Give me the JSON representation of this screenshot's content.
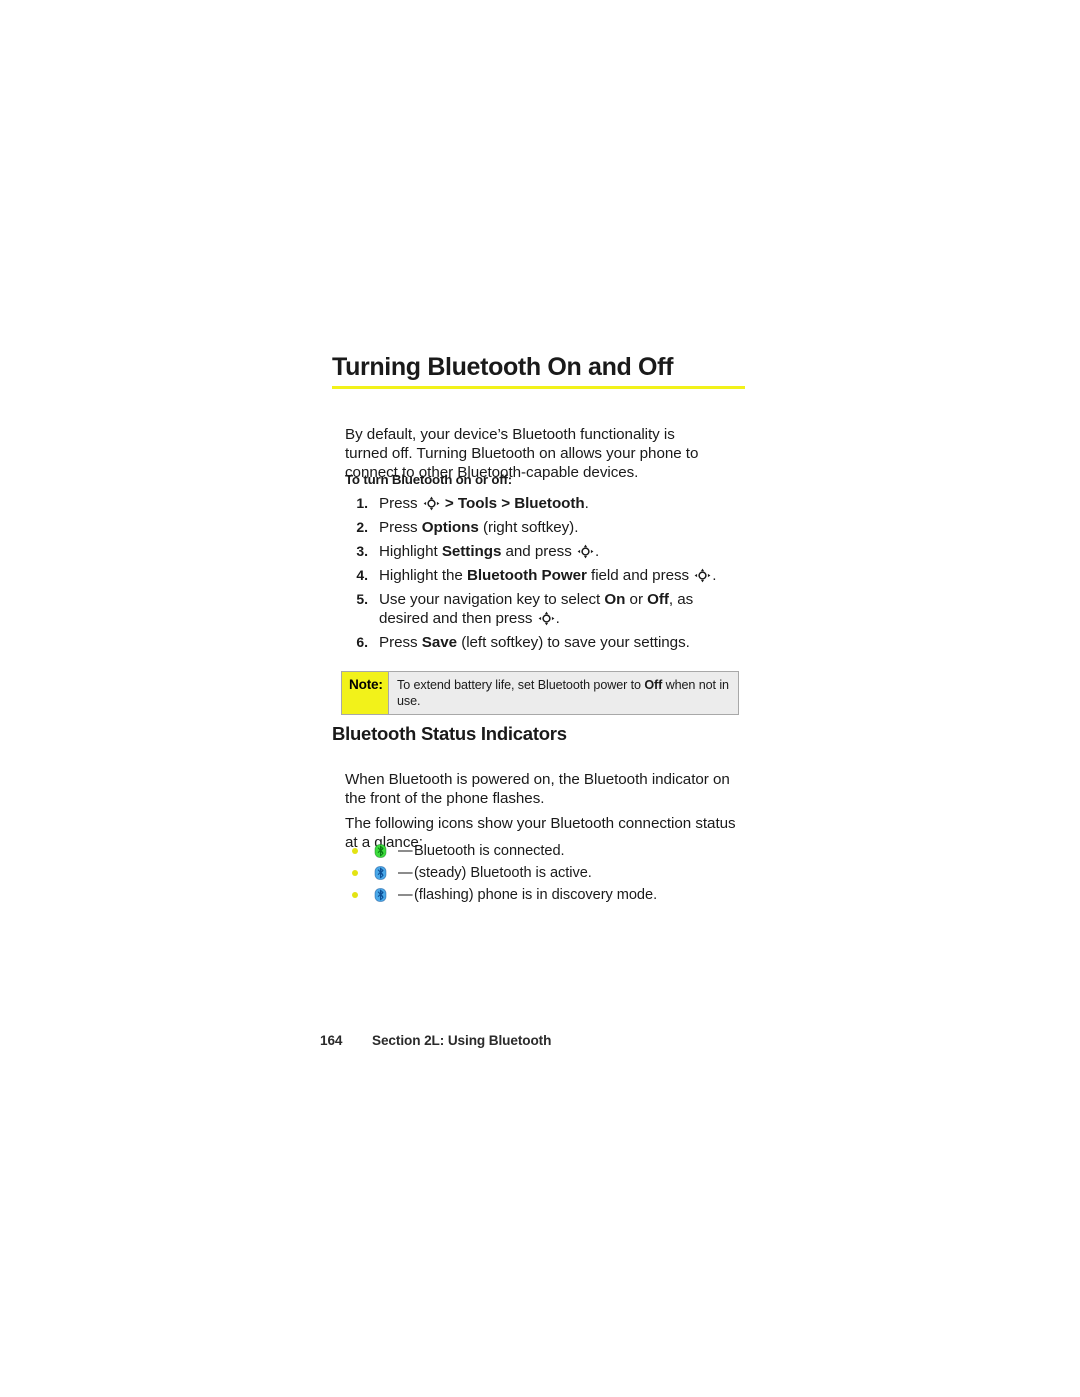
{
  "page": {
    "heading": "Turning Bluetooth On and Off",
    "rule_color": "#f2f21a",
    "intro": "By default, your device’s Bluetooth functionality is turned off. Turning Bluetooth on allows your phone to connect to other Bluetooth-capable devices.",
    "lead_in": "To turn Bluetooth on or off:"
  },
  "steps": [
    {
      "num": "1.",
      "parts": [
        {
          "t": "Press ",
          "b": false
        },
        {
          "t": "NAVKEY",
          "b": false,
          "icon": "navigation-key-icon"
        },
        {
          "t": " > ",
          "b": true
        },
        {
          "t": "Tools",
          "b": true
        },
        {
          "t": " > ",
          "b": true
        },
        {
          "t": "Bluetooth",
          "b": true
        },
        {
          "t": ".",
          "b": false
        }
      ],
      "plain": "Press (nav key) > Tools > Bluetooth."
    },
    {
      "num": "2.",
      "parts": [
        {
          "t": "Press ",
          "b": false
        },
        {
          "t": "Options",
          "b": true
        },
        {
          "t": " (right softkey).",
          "b": false
        }
      ],
      "plain": "Press Options (right softkey)."
    },
    {
      "num": "3.",
      "parts": [
        {
          "t": "Highlight ",
          "b": false
        },
        {
          "t": "Settings",
          "b": true
        },
        {
          "t": " and press ",
          "b": false
        },
        {
          "t": "NAVKEY",
          "b": false,
          "icon": "navigation-key-icon"
        },
        {
          "t": ".",
          "b": false
        }
      ],
      "plain": "Highlight Settings and press (nav key)."
    },
    {
      "num": "4.",
      "parts": [
        {
          "t": "Highlight the ",
          "b": false
        },
        {
          "t": "Bluetooth Power",
          "b": true
        },
        {
          "t": " field and press ",
          "b": false
        },
        {
          "t": "NAVKEY",
          "b": false,
          "icon": "navigation-key-icon"
        },
        {
          "t": ".",
          "b": false
        }
      ],
      "plain": "Highlight the Bluetooth Power field and press (nav key)."
    },
    {
      "num": "5.",
      "parts": [
        {
          "t": "Use your navigation key to select ",
          "b": false
        },
        {
          "t": "On",
          "b": true
        },
        {
          "t": " or ",
          "b": false
        },
        {
          "t": "Off",
          "b": true
        },
        {
          "t": ", as desired and then press ",
          "b": false
        },
        {
          "t": "NAVKEY",
          "b": false,
          "icon": "navigation-key-icon"
        },
        {
          "t": ".",
          "b": false
        }
      ],
      "plain": "Use your navigation key to select On or Off, as desired and then press (nav key)."
    },
    {
      "num": "6.",
      "parts": [
        {
          "t": "Press ",
          "b": false
        },
        {
          "t": "Save",
          "b": true
        },
        {
          "t": " (left softkey) to save your settings.",
          "b": false
        }
      ],
      "plain": "Press Save (left softkey) to save your settings."
    }
  ],
  "note": {
    "label": "Note:",
    "label_bg": "#f2f21a",
    "body_bg": "#ececec",
    "text_before": "To extend battery life, set Bluetooth power to ",
    "text_bold": "Off",
    "text_after": " when not in use."
  },
  "section": {
    "heading": "Bluetooth Status Indicators",
    "para1": "When Bluetooth is powered on, the Bluetooth indicator on the front of the phone flashes.",
    "para2": "The following icons show your Bluetooth connection status at a glance:"
  },
  "indicators": {
    "bullet_color": "#e3e313",
    "dash": "—",
    "items": [
      {
        "icon_name": "bluetooth-connected-icon",
        "icon_color": "#3ddc3d",
        "icon_color_dark": "#0a7a14",
        "text": "Bluetooth is connected."
      },
      {
        "icon_name": "bluetooth-active-icon",
        "icon_color": "#4aa8e8",
        "icon_color_dark": "#0d4f96",
        "text": "(steady) Bluetooth is active."
      },
      {
        "icon_name": "bluetooth-discovery-icon",
        "icon_color": "#4aa8e8",
        "icon_color_dark": "#0d4f96",
        "text": "(flashing) phone is in discovery mode."
      }
    ]
  },
  "footer": {
    "page_number": "164",
    "section_label": "Section 2L: Using Bluetooth"
  }
}
